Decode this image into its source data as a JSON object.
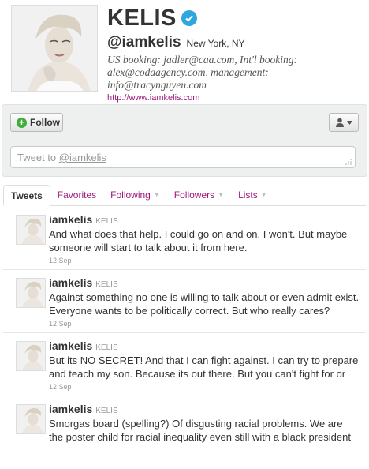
{
  "profile": {
    "name": "KELIS",
    "handle": "@iamkelis",
    "location": "New York, NY",
    "bio": "US booking: jadler@caa.com, Int'l booking: alex@codaagency.com, management: info@tracynguyen.com",
    "url": "http://www.iamkelis.com",
    "verified_color": "#2fa6de"
  },
  "actions": {
    "follow_label": "Follow",
    "tweet_to_prefix": "Tweet to ",
    "tweet_to_mention": "@iamkelis"
  },
  "tabs": [
    {
      "label": "Tweets",
      "active": true
    },
    {
      "label": "Favorites"
    },
    {
      "label": "Following",
      "caret": "▼"
    },
    {
      "label": "Followers",
      "caret": "▼"
    },
    {
      "label": "Lists",
      "caret": "▼"
    }
  ],
  "tweets": [
    {
      "handle": "iamkelis",
      "name": "KELIS",
      "text": "And what does that help. I could go on and on. I won't. But maybe someone will start to talk about it from here.",
      "time": "12 Sep"
    },
    {
      "handle": "iamkelis",
      "name": "KELIS",
      "text": "Against something no one is willing to talk about or even admit exist. Everyone wants to be politically correct. But who really cares?",
      "time": "12 Sep"
    },
    {
      "handle": "iamkelis",
      "name": "KELIS",
      "text": "But its NO SECRET! And that I can fight against. I can try to prepare and teach my son. Because its out there. But you can't fight for or",
      "time": "12 Sep"
    },
    {
      "handle": "iamkelis",
      "name": "KELIS",
      "text": "Smorgas board (spelling?) Of disgusting racial problems. We are the poster child for racial inequality even still with a black president",
      "time": ""
    }
  ],
  "colors": {
    "link": "#a0197d",
    "follow_plus": "#3eaf3b",
    "panel_bg": "#eef0f0"
  }
}
